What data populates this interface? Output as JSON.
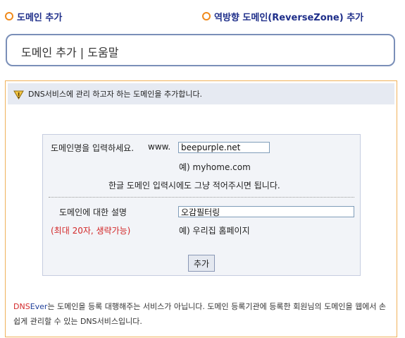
{
  "top_links": {
    "add_domain": "도메인 추가",
    "add_reverse": "역방향 도메인(ReverseZone) 추가"
  },
  "title": "도메인 추가 | 도움말",
  "info": {
    "icon": "warning-icon",
    "text": "DNS서비스에 관리 하고자 하는 도메인을 추가합니다."
  },
  "form": {
    "domain_label": "도메인명을 입력하세요.",
    "www_prefix": "www.",
    "domain_value": "beepurple.net",
    "domain_example": "예) myhome.com",
    "hangul_note": "한글 도메인 입력시에도 그냥 적어주시면 됩니다.",
    "desc_label": "도메인에 대한 설명",
    "desc_value": "오감필터링",
    "desc_limit": "(최대 20자, 생략가능)",
    "desc_example": "예) 우리집 홈페이지",
    "submit_label": "추가"
  },
  "footer": {
    "brand_dns": "DNS",
    "brand_ever": "Ever",
    "text": "는 도메인을 등록 대행해주는 서비스가 아닙니다. 도메인 등록기관에 등록한 회원님의 도메인을 웹에서 손쉽게 관리할 수 있는 DNS서비스입니다."
  },
  "colors": {
    "link": "#1f2f8a",
    "bullet": "#f08a1c",
    "panel_border": "#f0b15a",
    "info_bg": "#e6eaf2",
    "accent_red": "#d3292a"
  }
}
